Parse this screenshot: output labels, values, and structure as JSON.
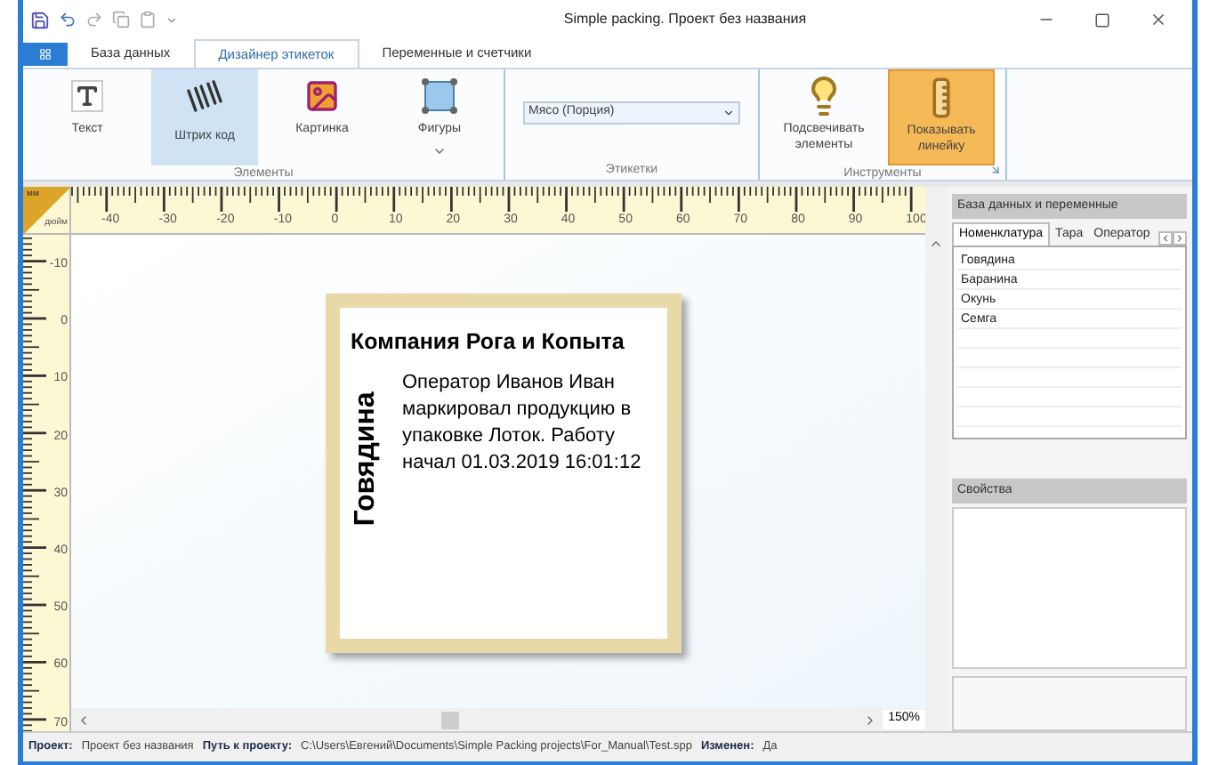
{
  "window": {
    "title": "Simple packing. Проект без названия"
  },
  "ribbon": {
    "tabs": [
      {
        "label": "База данных",
        "selected": false
      },
      {
        "label": "Дизайнер этикеток",
        "selected": true
      },
      {
        "label": "Переменные и счетчики",
        "selected": false
      }
    ],
    "groups": [
      {
        "kind": "buttons",
        "label": "Элементы",
        "buttons": [
          {
            "label": "Текст",
            "highlighted": false,
            "checked": false,
            "has_menu": false
          },
          {
            "label": "Штрих код",
            "highlighted": true,
            "checked": false,
            "has_menu": false
          },
          {
            "label": "Картинка",
            "highlighted": false,
            "checked": false,
            "has_menu": false
          },
          {
            "label": "Фигуры",
            "highlighted": false,
            "checked": false,
            "has_menu": true
          }
        ]
      },
      {
        "kind": "dropdown",
        "label": "Этикетки",
        "value": "Мясо (Порция)"
      },
      {
        "kind": "buttons",
        "label": "Инструменты",
        "launcher": true,
        "buttons": [
          {
            "label": "Подсвечивать элементы",
            "highlighted": false,
            "checked": false,
            "has_menu": false
          },
          {
            "label": "Показывать линейку",
            "highlighted": false,
            "checked": true,
            "has_menu": false
          }
        ]
      }
    ]
  },
  "rulers": {
    "corner": [
      "мм",
      "дюйм"
    ],
    "horizontal": [
      "-40",
      "-30",
      "-20",
      "-10",
      "0",
      "10",
      "20",
      "30",
      "40",
      "50",
      "60",
      "70",
      "80",
      "90",
      "100"
    ],
    "vertical": [
      "-10",
      "0",
      "10",
      "20",
      "30",
      "40",
      "50",
      "60",
      "70"
    ]
  },
  "label": {
    "title": "Компания Рога и Копыта",
    "side_text": "Говядина",
    "body": "Оператор Иванов Иван маркировал продукцию в упаковке Лоток. Работу начал 01.03.2019 16:01:12"
  },
  "zoom": "150%",
  "side_panel": {
    "database": {
      "title": "База данных и переменные",
      "tabs": [
        {
          "label": "Номенклатура",
          "selected": true
        },
        {
          "label": "Тара",
          "selected": false
        },
        {
          "label": "Оператор",
          "selected": false
        }
      ],
      "items": [
        "Говядина",
        "Баранина",
        "Окунь",
        "Семга"
      ]
    },
    "properties": {
      "title": "Свойства"
    }
  },
  "status_bar": [
    {
      "key": "Проект:",
      "value": "Проект без названия"
    },
    {
      "key": "Путь к проекту:",
      "value": "C:\\Users\\Евгений\\Documents\\Simple Packing projects\\For_Manual\\Test.spp"
    },
    {
      "key": "Изменен:",
      "value": "Да"
    }
  ]
}
